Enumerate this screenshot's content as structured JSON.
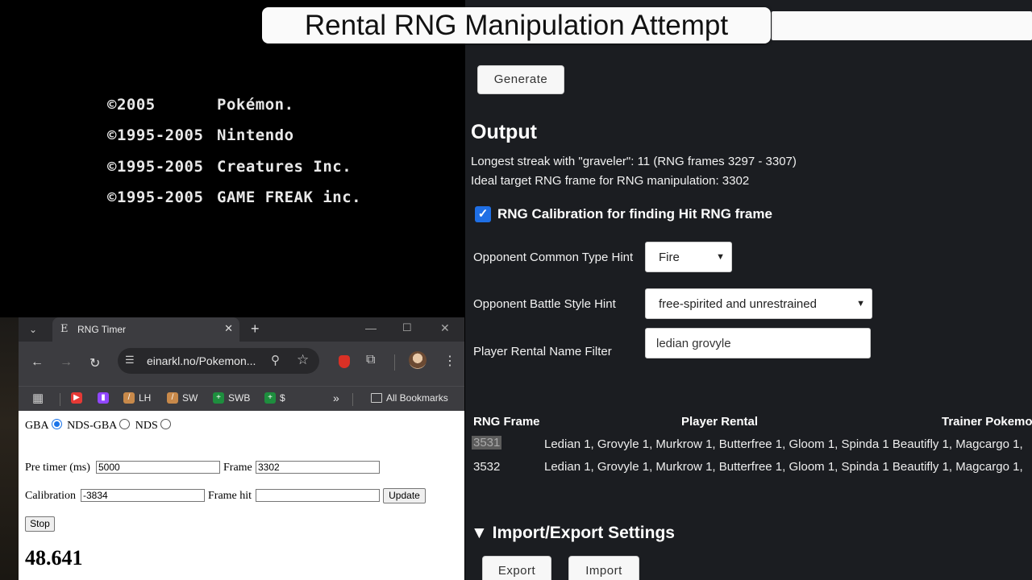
{
  "overlay": {
    "title": "Rental RNG Manipulation Attempt"
  },
  "game": {
    "rows": [
      {
        "year": "©2005",
        "owner": "Pokémon."
      },
      {
        "year": "©1995-2005",
        "owner": "Nintendo"
      },
      {
        "year": "©1995-2005",
        "owner": "Creatures Inc."
      },
      {
        "year": "©1995-2005",
        "owner": "GAME FREAK inc."
      }
    ]
  },
  "panel": {
    "generate_label": "Generate",
    "output_heading": "Output",
    "output_lines": [
      "Longest streak with \"graveler\": 11 (RNG frames 3297 - 3307)",
      "Ideal target RNG frame for RNG manipulation: 3302"
    ],
    "calibration_checkbox_label": "RNG Calibration for finding Hit RNG frame",
    "calibration_checked": true,
    "type_hint_label": "Opponent Common Type Hint",
    "type_hint_value": "Fire",
    "style_hint_label": "Opponent Battle Style Hint",
    "style_hint_value": "free-spirited and unrestrained",
    "name_filter_label": "Player Rental Name Filter",
    "name_filter_value": "ledian grovyle",
    "table": {
      "headers": [
        "RNG Frame",
        "Player Rental",
        "Trainer Pokemo"
      ],
      "rows": [
        {
          "frame": "3531",
          "rental": "Ledian 1, Grovyle 1, Murkrow 1, Butterfree 1, Gloom 1, Spinda 1 Beautifly 1, Magcargo 1,"
        },
        {
          "frame": "3532",
          "rental": "Ledian 1, Grovyle 1, Murkrow 1, Butterfree 1, Gloom 1, Spinda 1 Beautifly 1, Magcargo 1,"
        }
      ]
    },
    "import_export_heading": "▼ Import/Export Settings",
    "export_label": "Export",
    "import_label": "Import"
  },
  "browser": {
    "tab_title": "RNG Timer",
    "favicon_letter": "E",
    "url": "einarkl.no/Pokemon...",
    "bookmarks": [
      {
        "label": "",
        "icon": "youtube-icon",
        "color": "#e53935"
      },
      {
        "label": "",
        "icon": "twitch-icon",
        "color": "#9146ff"
      },
      {
        "label": "LH",
        "icon": "bat-icon",
        "color": "#d4a35a"
      },
      {
        "label": "SW",
        "icon": "bat-icon",
        "color": "#d4a35a"
      },
      {
        "label": "SWB",
        "icon": "sheets-icon",
        "color": "#1e8e3e"
      },
      {
        "label": "$",
        "icon": "sheets-icon",
        "color": "#1e8e3e"
      }
    ],
    "all_bookmarks_label": "All Bookmarks",
    "content": {
      "mode_gba": "GBA",
      "mode_ndsgba": "NDS-GBA",
      "mode_nds": "NDS",
      "selected_mode": "GBA",
      "pre_timer_label": "Pre timer (ms)",
      "pre_timer_value": "5000",
      "frame_label": "Frame",
      "frame_value": "3302",
      "calibration_label": "Calibration",
      "calibration_value": "-3834",
      "frame_hit_label": "Frame hit",
      "frame_hit_value": "",
      "update_label": "Update",
      "stop_label": "Stop",
      "timer_value": "48.641"
    }
  }
}
